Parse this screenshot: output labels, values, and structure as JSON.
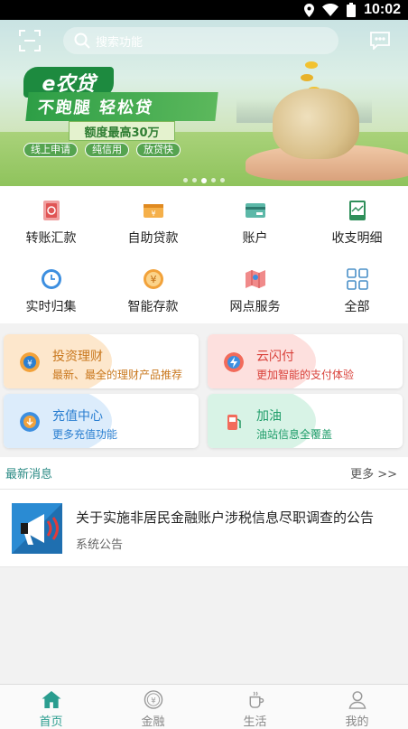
{
  "status_bar": {
    "time": "10:02"
  },
  "banner": {
    "search_placeholder": "搜索功能",
    "brand": "e农贷",
    "slogan": "不跑腿  轻松贷",
    "limit_text": "额度最高30万",
    "tags": [
      "线上申请",
      "纯信用",
      "放贷快"
    ],
    "page_count": 5,
    "active_page": 2
  },
  "functions": [
    {
      "label": "转账汇款",
      "icon": "transfer-icon"
    },
    {
      "label": "自助贷款",
      "icon": "loan-icon"
    },
    {
      "label": "账户",
      "icon": "account-card-icon"
    },
    {
      "label": "收支明细",
      "icon": "statement-icon"
    },
    {
      "label": "实时归集",
      "icon": "clock-icon"
    },
    {
      "label": "智能存款",
      "icon": "yuan-coin-icon"
    },
    {
      "label": "网点服务",
      "icon": "map-icon"
    },
    {
      "label": "全部",
      "icon": "grid-icon"
    }
  ],
  "cards": [
    {
      "title": "投资理财",
      "subtitle": "最新、最全的理财产品推荐",
      "icon": "yuan-coin-icon",
      "title_color": "#c9781e",
      "sub_color": "#c9781e"
    },
    {
      "title": "云闪付",
      "subtitle": "更加智能的支付体验",
      "icon": "lightning-icon",
      "title_color": "#d9423b",
      "sub_color": "#d9423b"
    },
    {
      "title": "充值中心",
      "subtitle": "更多充值功能",
      "icon": "recharge-icon",
      "title_color": "#2b7fd1",
      "sub_color": "#2b7fd1"
    },
    {
      "title": "加油",
      "subtitle": "油站信息全覆盖",
      "icon": "fuel-pump-icon",
      "title_color": "#1f9d6a",
      "sub_color": "#1f9d6a"
    }
  ],
  "news": {
    "section_title": "最新消息",
    "more_label": "更多 >>",
    "items": [
      {
        "title": "关于实施非居民金融账户涉税信息尽职调查的公告",
        "category": "系统公告"
      }
    ]
  },
  "tabs": [
    {
      "label": "首页",
      "icon": "home-icon",
      "active": true
    },
    {
      "label": "金融",
      "icon": "yuan-circle-icon",
      "active": false
    },
    {
      "label": "生活",
      "icon": "coffee-cup-icon",
      "active": false
    },
    {
      "label": "我的",
      "icon": "user-icon",
      "active": false
    }
  ],
  "colors": {
    "accent": "#2a9d8f",
    "banner_green": "#1d8a3f"
  }
}
